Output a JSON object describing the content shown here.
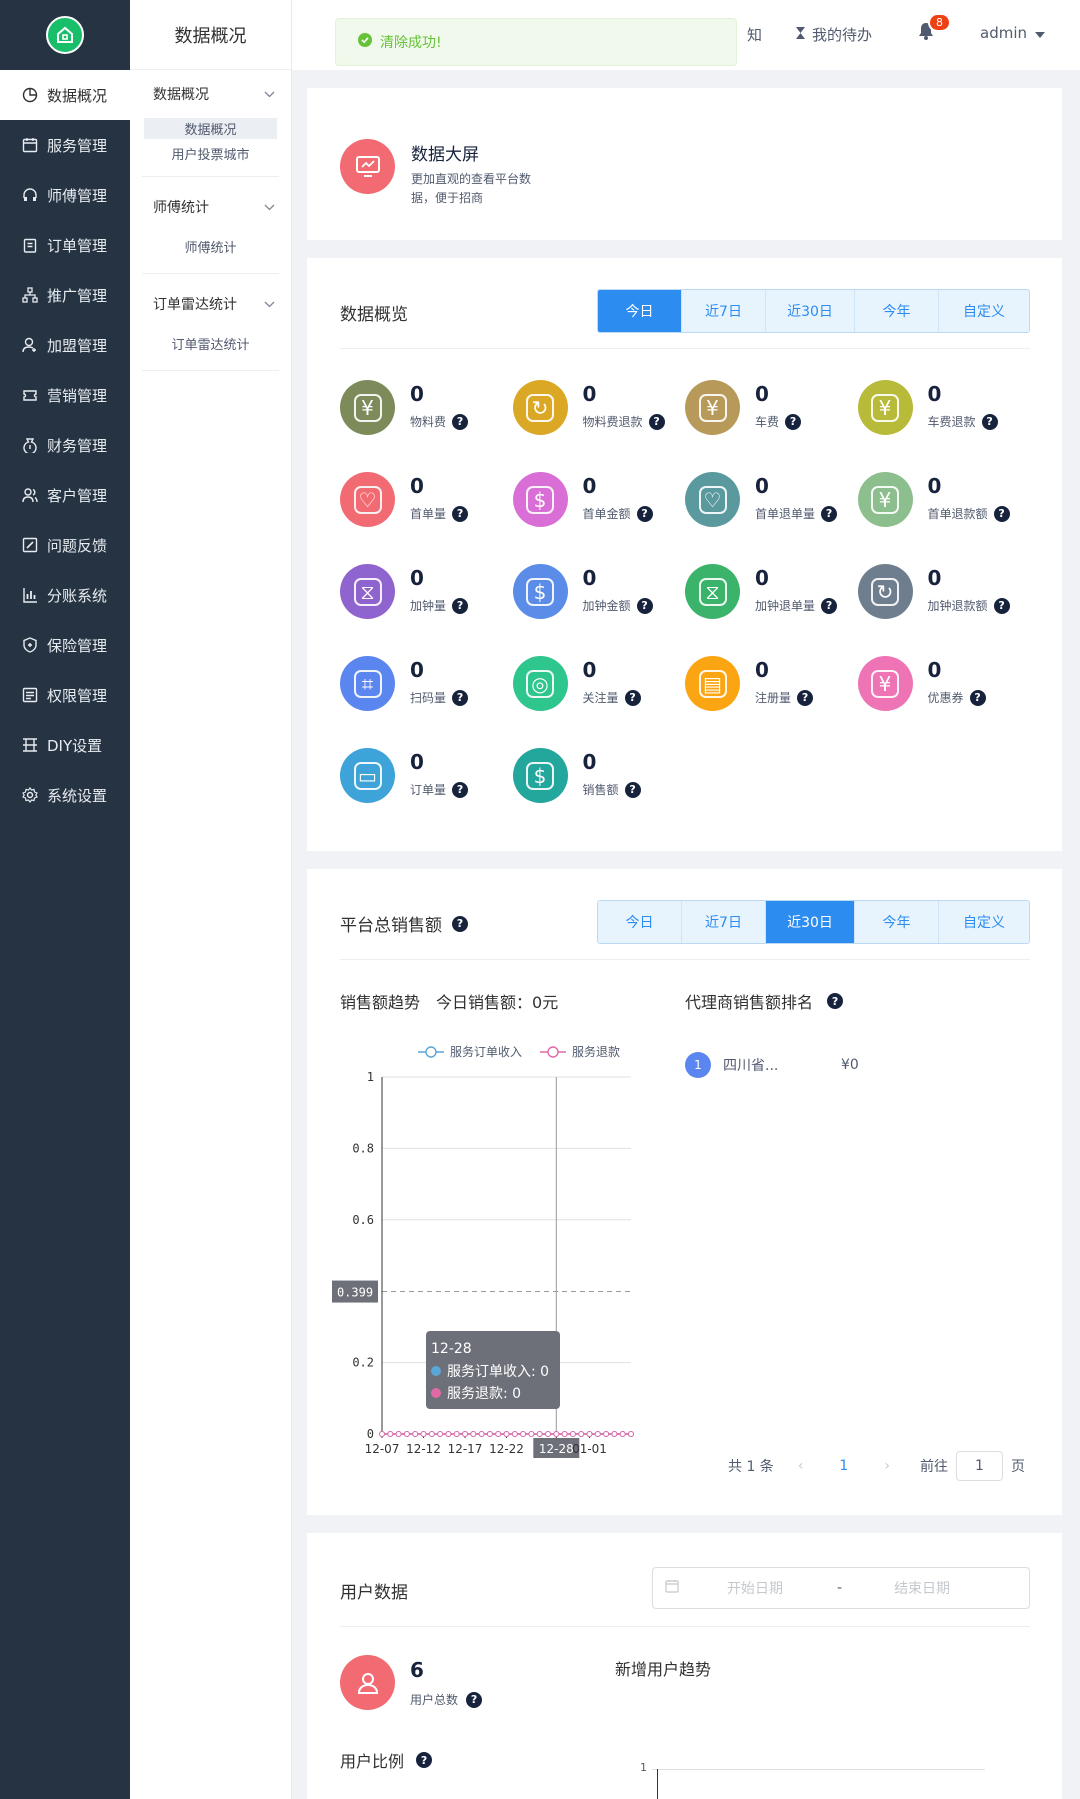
{
  "sidebar": {
    "items": [
      {
        "label": "数据概况",
        "icon": "pie-chart-icon"
      },
      {
        "label": "服务管理",
        "icon": "calendar-icon"
      },
      {
        "label": "师傅管理",
        "icon": "headset-icon"
      },
      {
        "label": "订单管理",
        "icon": "clipboard-icon"
      },
      {
        "label": "推广管理",
        "icon": "hierarchy-icon"
      },
      {
        "label": "加盟管理",
        "icon": "user-add-icon"
      },
      {
        "label": "营销管理",
        "icon": "ticket-icon"
      },
      {
        "label": "财务管理",
        "icon": "money-bag-icon"
      },
      {
        "label": "客户管理",
        "icon": "users-icon"
      },
      {
        "label": "问题反馈",
        "icon": "edit-icon"
      },
      {
        "label": "分账系统",
        "icon": "bar-chart-icon"
      },
      {
        "label": "保险管理",
        "icon": "shield-icon"
      },
      {
        "label": "权限管理",
        "icon": "key-list-icon"
      },
      {
        "label": "DIY设置",
        "icon": "layout-icon"
      },
      {
        "label": "系统设置",
        "icon": "gear-icon"
      }
    ]
  },
  "subside": {
    "title": "数据概况",
    "groups": [
      {
        "label": "数据概况",
        "items": [
          "数据概况",
          "用户投票城市"
        ]
      },
      {
        "label": "师傅统计",
        "items": [
          "师傅统计"
        ]
      },
      {
        "label": "订单雷达统计",
        "items": [
          "订单雷达统计"
        ]
      }
    ]
  },
  "topbar": {
    "toast": "清除成功!",
    "notice": "知",
    "todo": "我的待办",
    "badge": "8",
    "user": "admin"
  },
  "screen": {
    "title": "数据大屏",
    "desc1": "更加直观的查看平台数",
    "desc2": "据，便于招商"
  },
  "overview": {
    "title": "数据概览",
    "tabs": [
      "今日",
      "近7日",
      "近30日",
      "今年",
      "自定义"
    ],
    "active_tab": "今日",
    "stats": [
      {
        "value": "0",
        "label": "物料费",
        "color": "#7d8b5a"
      },
      {
        "value": "0",
        "label": "物料费退款",
        "color": "#dba826"
      },
      {
        "value": "0",
        "label": "车费",
        "color": "#b79a5a"
      },
      {
        "value": "0",
        "label": "车费退款",
        "color": "#b8ba3a"
      },
      {
        "value": "0",
        "label": "首单量",
        "color": "#f26b73"
      },
      {
        "value": "0",
        "label": "首单金额",
        "color": "#d96fd6"
      },
      {
        "value": "0",
        "label": "首单退单量",
        "color": "#5a9a9e"
      },
      {
        "value": "0",
        "label": "首单退款额",
        "color": "#8dbf8e"
      },
      {
        "value": "0",
        "label": "加钟量",
        "color": "#9064cf"
      },
      {
        "value": "0",
        "label": "加钟金额",
        "color": "#5b8de8"
      },
      {
        "value": "0",
        "label": "加钟退单量",
        "color": "#3bb36b"
      },
      {
        "value": "0",
        "label": "加钟退款额",
        "color": "#6f7e8e"
      },
      {
        "value": "0",
        "label": "扫码量",
        "color": "#5b86f0"
      },
      {
        "value": "0",
        "label": "关注量",
        "color": "#2fc68d"
      },
      {
        "value": "0",
        "label": "注册量",
        "color": "#fba512"
      },
      {
        "value": "0",
        "label": "优惠券",
        "color": "#ee74b6"
      },
      {
        "value": "0",
        "label": "订单量",
        "color": "#3ea3d8"
      },
      {
        "value": "0",
        "label": "销售额",
        "color": "#23a69b"
      }
    ]
  },
  "sales": {
    "title": "平台总销售额",
    "tabs": [
      "今日",
      "近7日",
      "近30日",
      "今年",
      "自定义"
    ],
    "active_tab": "近30日",
    "trend_title": "销售额趋势",
    "today_sales": "今日销售额：0元",
    "ranking_title": "代理商销售额排名",
    "ranking": [
      {
        "rank": "1",
        "name": "四川省...",
        "amount": "¥0"
      }
    ],
    "pagination": {
      "total": "共 1 条",
      "current": "1",
      "goto": "前往",
      "page_input": "1",
      "page_suffix": "页"
    }
  },
  "chart_data": {
    "type": "line",
    "legend": [
      "服务订单收入",
      "服务退款"
    ],
    "series": [
      {
        "name": "服务订单收入",
        "color": "#5aa6d8",
        "values": [
          0,
          0,
          0,
          0,
          0,
          0,
          0,
          0,
          0,
          0,
          0,
          0,
          0,
          0,
          0,
          0,
          0,
          0,
          0,
          0,
          0,
          0,
          0,
          0,
          0,
          0,
          0,
          0,
          0,
          0,
          0
        ]
      },
      {
        "name": "服务退款",
        "color": "#e06aa6",
        "values": [
          0,
          0,
          0,
          0,
          0,
          0,
          0,
          0,
          0,
          0,
          0,
          0,
          0,
          0,
          0,
          0,
          0,
          0,
          0,
          0,
          0,
          0,
          0,
          0,
          0,
          0,
          0,
          0,
          0,
          0,
          0
        ]
      }
    ],
    "x_ticks": [
      "12-07",
      "12-12",
      "12-17",
      "12-22",
      "12-28",
      "01-01"
    ],
    "y_ticks": [
      "0",
      "0.2",
      "0.399",
      "0.6",
      "0.8",
      "1"
    ],
    "ylim": [
      0,
      1
    ],
    "crosshair_y_label": "0.399",
    "crosshair_x_label": "12-28",
    "tooltip": {
      "date": "12-28",
      "rows": [
        "服务订单收入: 0",
        "服务退款: 0"
      ]
    }
  },
  "users": {
    "title": "用户数据",
    "start_placeholder": "开始日期",
    "end_placeholder": "结束日期",
    "dash": "-",
    "total_value": "6",
    "total_label": "用户总数",
    "trend_title": "新增用户趋势",
    "ratio_title": "用户比例",
    "trend_y_tick": "1"
  }
}
